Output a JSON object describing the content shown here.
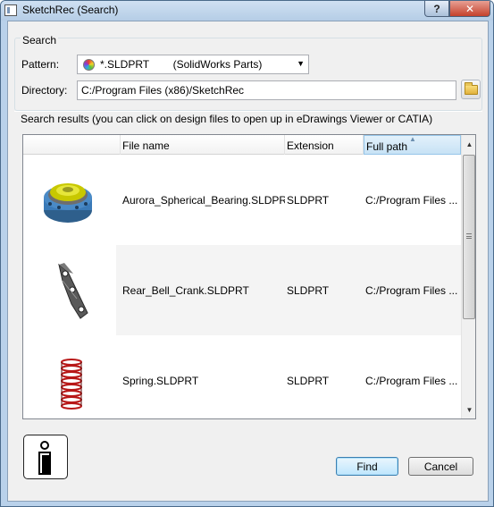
{
  "window": {
    "title": "SketchRec (Search)",
    "help_label": "?",
    "close_label": "✕"
  },
  "search": {
    "legend": "Search",
    "pattern_label": "Pattern:",
    "pattern_value": "*.SLDPRT        (SolidWorks Parts)",
    "directory_label": "Directory:",
    "directory_value": "C:/Program Files (x86)/SketchRec"
  },
  "results": {
    "label": "Search results (you can click on design files to open up in eDrawings Viewer or CATIA)",
    "columns": [
      "",
      "File name",
      "Extension",
      "Full path"
    ],
    "sorted_column": "Full path",
    "rows": [
      {
        "thumbnail": "bearing",
        "file_name": "Aurora_Spherical_Bearing.SLDPRT",
        "extension": "SLDPRT",
        "full_path": "C:/Program Files ..."
      },
      {
        "thumbnail": "bell-crank",
        "file_name": "Rear_Bell_Crank.SLDPRT",
        "extension": "SLDPRT",
        "full_path": "C:/Program Files ..."
      },
      {
        "thumbnail": "spring",
        "file_name": "Spring.SLDPRT",
        "extension": "SLDPRT",
        "full_path": "C:/Program Files ..."
      }
    ]
  },
  "buttons": {
    "find": "Find",
    "cancel": "Cancel"
  },
  "colors": {
    "title_bg": "#b9d1ea",
    "close_red": "#c4412c",
    "bearing_yellow": "#d8d800",
    "bearing_blue": "#3a7ab8",
    "spring_red": "#b81818"
  }
}
